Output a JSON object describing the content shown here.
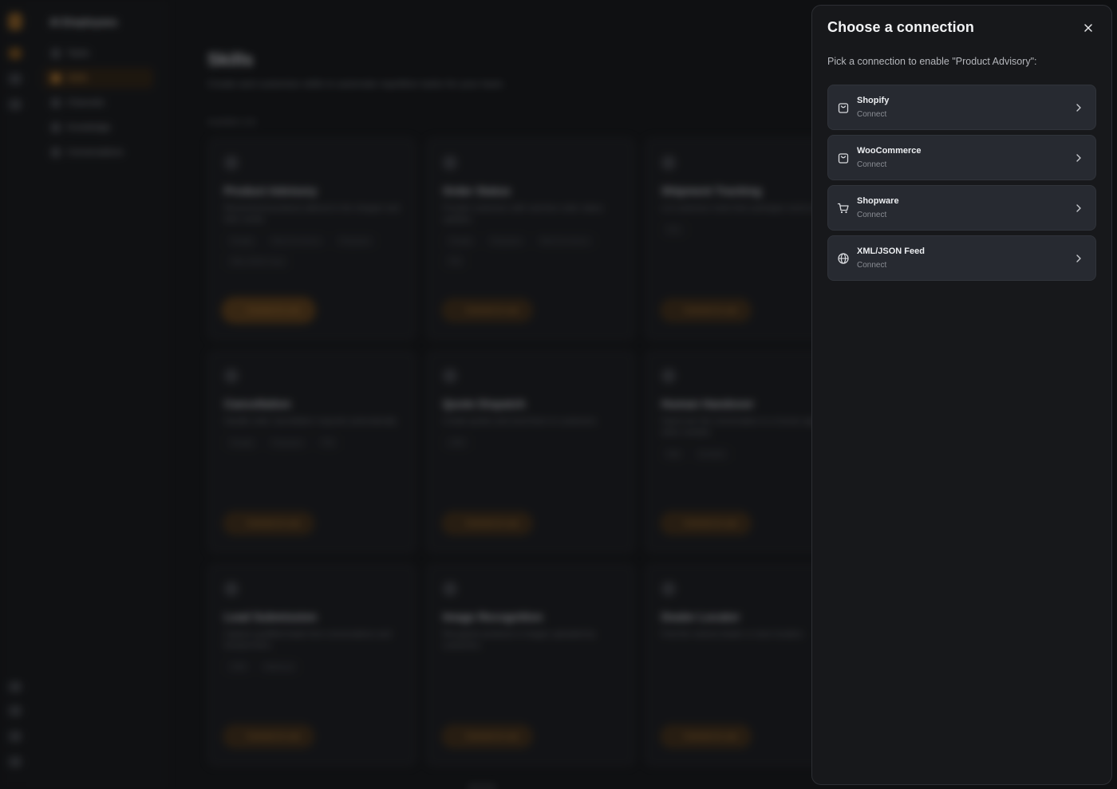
{
  "background": {
    "brand": "AI Employees",
    "nav": [
      "Tasks",
      "Skills",
      "Channels",
      "Knowledge",
      "Conversations"
    ],
    "page_title": "Skills",
    "page_subtitle": "Create and customize skills to automate repetitive tasks for your team.",
    "count_label": "Available (12)",
    "cards": [
      {
        "title": "Product Advisory",
        "desc": "Recommend products tailored to the shopper and their needs.",
        "tags": [
          "Shopify",
          "WooCommerce",
          "Shopware",
          "XML/JSON Feed"
        ],
        "button": "Connect to use"
      },
      {
        "title": "Order Status",
        "desc": "Provide customers with real-time order status updates.",
        "tags": [
          "Shopify",
          "Shopware",
          "WooCommerce",
          "PIM"
        ],
        "button": "Connect to use"
      },
      {
        "title": "Shipment Tracking",
        "desc": "Let customers track their packages end-to-end.",
        "tags": [
          "DHL"
        ],
        "button": "Connect to use"
      },
      {
        "title": "",
        "desc": "",
        "tags": [],
        "button": "Connect to use"
      },
      {
        "title": "Cancellation",
        "desc": "Handle order cancellation requests automatically.",
        "tags": [
          "Shopify",
          "Shopware",
          "PIM"
        ],
        "button": "Connect to use"
      },
      {
        "title": "Quote Dispatch",
        "desc": "Create quotes and send them to customers.",
        "tags": [
          "CRM"
        ],
        "button": "Connect to use"
      },
      {
        "title": "Human Handover",
        "desc": "Hand over the conversation to a human agent when needed.",
        "tags": [
          "Mail",
          "Zendesk"
        ],
        "button": "Connect to use"
      },
      {
        "title": "",
        "desc": "",
        "tags": [],
        "button": "Connect to use"
      },
      {
        "title": "Lead Submission",
        "desc": "Capture qualified leads from conversations and forward them.",
        "tags": [
          "CRM",
          "Webhook"
        ],
        "button": "Connect to use"
      },
      {
        "title": "Image Recognition",
        "desc": "Recognize products in images uploaded by customers.",
        "tags": [],
        "button": "Connect to use"
      },
      {
        "title": "Dealer Locator",
        "desc": "Find the nearest dealer or store location.",
        "tags": [],
        "button": "Connect to use"
      },
      {
        "title": "",
        "desc": "",
        "tags": [],
        "button": ""
      }
    ]
  },
  "modal": {
    "title": "Choose a connection",
    "description": "Pick a connection to enable \"Product Advisory\":",
    "connections": [
      {
        "name": "Shopify",
        "status": "Connect",
        "icon": "shopping-bag-icon"
      },
      {
        "name": "WooCommerce",
        "status": "Connect",
        "icon": "shopping-bag-icon"
      },
      {
        "name": "Shopware",
        "status": "Connect",
        "icon": "shopping-cart-icon"
      },
      {
        "name": "XML/JSON Feed",
        "status": "Connect",
        "icon": "globe-icon"
      }
    ]
  }
}
